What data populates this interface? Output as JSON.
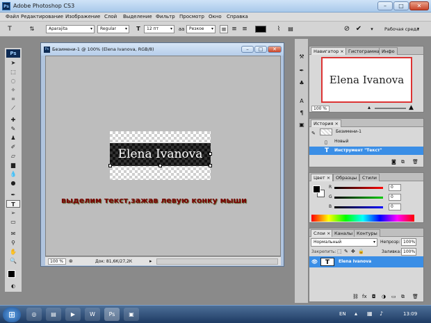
{
  "window": {
    "title": "Adobe Photoshop CS3",
    "ps_badge": "Ps",
    "min": "–",
    "max": "□",
    "close": "✕"
  },
  "menu": [
    "Файл",
    "Редактирование",
    "Изображение",
    "Слой",
    "Выделение",
    "Фильтр",
    "Просмотр",
    "Окно",
    "Справка"
  ],
  "options": {
    "tool_icon": "T",
    "font_family": "Aparajita",
    "font_style": "Regular",
    "font_size": "12 пт",
    "antialias": "Резкое",
    "workspace": "Рабочая среда"
  },
  "toolbox": {
    "logo": "Ps"
  },
  "document": {
    "title": "Безимени-1 @ 100% (Elena Ivanova, RGB/8)",
    "canvas_text": "Elena Ivanova",
    "instruction": "выделим текст,зажав левую конку мыши",
    "zoom": "100 %",
    "status": "Док: 81,6К/27,2К"
  },
  "navigator": {
    "tabs": [
      "Навигатор ×",
      "Гистограмма",
      "Инфо"
    ],
    "preview_text": "Elena Ivanova",
    "zoom": "100 %"
  },
  "history": {
    "tab": "История ×",
    "snapshot": "Безимени-1",
    "items": [
      "Новый",
      "Инструмент \"Текст\""
    ]
  },
  "color": {
    "tabs": [
      "Цвет ×",
      "Образцы",
      "Стили"
    ],
    "channels": [
      {
        "label": "R",
        "value": "0"
      },
      {
        "label": "G",
        "value": "0"
      },
      {
        "label": "B",
        "value": "0"
      }
    ]
  },
  "layers": {
    "tabs": [
      "Слои ×",
      "Каналы",
      "Контуры"
    ],
    "blend_mode": "Нормальный",
    "opacity_label": "Непрозр:",
    "opacity": "100%",
    "lock_label": "Закрепить:",
    "fill_label": "Заливка:",
    "fill": "100%",
    "layer_name": "Elena Ivanova",
    "layer_icon": "T"
  },
  "taskbar": {
    "lang": "EN",
    "time": "13:09"
  }
}
